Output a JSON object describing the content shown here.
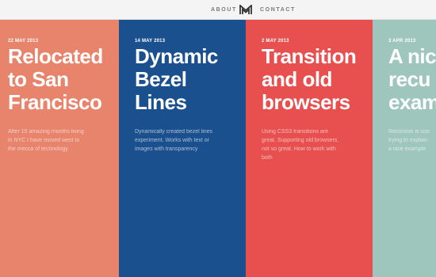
{
  "nav": {
    "about_label": "ABOUT",
    "contact_label": "CONTACT",
    "logo_icon": "monogram-logo-icon",
    "background": "#f4f4f4",
    "link_color": "#7a7a7a"
  },
  "posts": [
    {
      "date": "22 MAY 2013",
      "title": "Relocated\nto San\nFrancisco",
      "excerpt": "After 15 amazing months living\nin NYC I have moved west to\nthe mecca of technology",
      "color": "#e8836c"
    },
    {
      "date": "14 MAY 2013",
      "title": "Dynamic\nBezel\nLines",
      "excerpt": "Dynamically created bezel lines\nexperiment. Works with text or\nimages with transparency",
      "color": "#1b508f"
    },
    {
      "date": "2 MAY 2013",
      "title": "Transition\nand old\nbrowsers",
      "excerpt": "Using CSS3 transitions are\ngreat. Supporting old browsers,\nnot so great. How to work with\nboth",
      "color": "#e84f4f"
    },
    {
      "date": "3 APR 2013",
      "title": "A nic\nrecu\nexam",
      "excerpt": "Recursion is coo\ntrying to explain\na nice example",
      "color": "#9ec6bc"
    }
  ]
}
